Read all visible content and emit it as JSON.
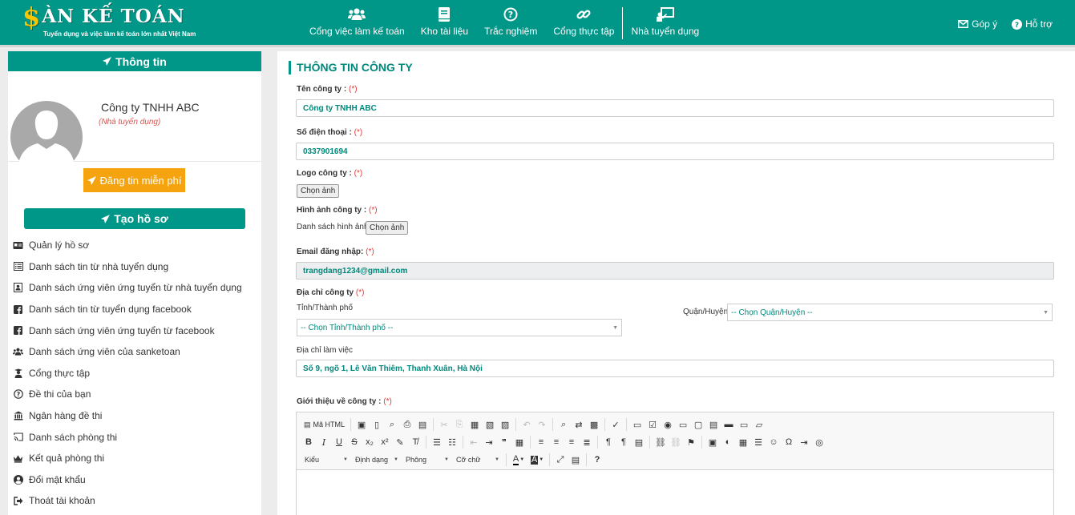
{
  "header": {
    "logo_title": "ÀN KẾ TOÁN",
    "logo_dollar": "$",
    "logo_subtitle": "Tuyển dụng và việc làm kế toán lớn nhất Việt Nam",
    "nav": [
      {
        "label": "Cổng việc làm kế toán",
        "icon": "users-icon"
      },
      {
        "label": "Kho tài liệu",
        "icon": "book-icon"
      },
      {
        "label": "Trắc nghiệm",
        "icon": "question-circle-icon"
      },
      {
        "label": "Cổng thực tập",
        "icon": "link-icon"
      },
      {
        "label": "Nhà tuyển dụng",
        "icon": "presentation-icon"
      }
    ],
    "feedback": "Góp ý",
    "support": "Hỗ trợ"
  },
  "sidebar": {
    "title": "Thông tin",
    "company_name": "Công ty TNHH ABC",
    "company_role": "(Nhà tuyển dụng)",
    "post_button": "Đăng tin miễn phí",
    "create_button": "Tạo hồ sơ",
    "menu": [
      {
        "label": "Quản lý hồ sơ",
        "icon": "id-card-icon"
      },
      {
        "label": "Danh sách tin từ nhà tuyển dụng",
        "icon": "list-alt-icon"
      },
      {
        "label": "Danh sách ứng viên ứng tuyển từ nhà tuyển dụng",
        "icon": "contact-book-icon"
      },
      {
        "label": "Danh sách tin từ tuyển dụng facebook",
        "icon": "facebook-icon"
      },
      {
        "label": "Danh sách ứng viên ứng tuyển từ facebook",
        "icon": "facebook-icon"
      },
      {
        "label": "Danh sách ứng viên của sanketoan",
        "icon": "users-icon"
      },
      {
        "label": "Cổng thực tập",
        "icon": "graduate-icon"
      },
      {
        "label": "Đề thi của bạn",
        "icon": "question-circle-icon"
      },
      {
        "label": "Ngân hàng đề thi",
        "icon": "bank-icon"
      },
      {
        "label": "Danh sách phòng thi",
        "icon": "cast-icon"
      },
      {
        "label": "Kết quả phòng thi",
        "icon": "crown-icon"
      },
      {
        "label": "Đổi mật khẩu",
        "icon": "user-circle-icon"
      },
      {
        "label": "Thoát tài khoản",
        "icon": "sign-out-icon"
      }
    ]
  },
  "form": {
    "title": "THÔNG TIN CÔNG TY",
    "required_mark": "(*)",
    "company_name_label": "Tên công ty :",
    "company_name_value": "Công ty TNHH ABC",
    "phone_label": "Số điện thoại :",
    "phone_value": "0337901694",
    "logo_label": "Logo công ty :",
    "choose_image": "Chọn ảnh",
    "images_label": "Hình ảnh công ty :",
    "images_list_label": "Danh sách hình ảnh",
    "email_label": "Email đăng nhập:",
    "email_value": "trangdang1234@gmail.com",
    "address_label": "Địa chỉ công ty",
    "province_label": "Tỉnh/Thành phố",
    "province_value": "-- Chọn Tỉnh/Thành phố --",
    "district_label": "Quận/Huyện",
    "district_value": "-- Chọn Quận/Huyện --",
    "work_address_label": "Địa chỉ làm việc",
    "work_address_value": "Số 9, ngõ 1, Lê Văn Thiêm, Thanh Xuân, Hà Nội",
    "intro_label": "Giới thiệu về công ty :"
  },
  "editor": {
    "source_label": "Mã HTML",
    "combos": [
      "Kiểu",
      "Định dạng",
      "Phông",
      "Cỡ chữ"
    ]
  }
}
